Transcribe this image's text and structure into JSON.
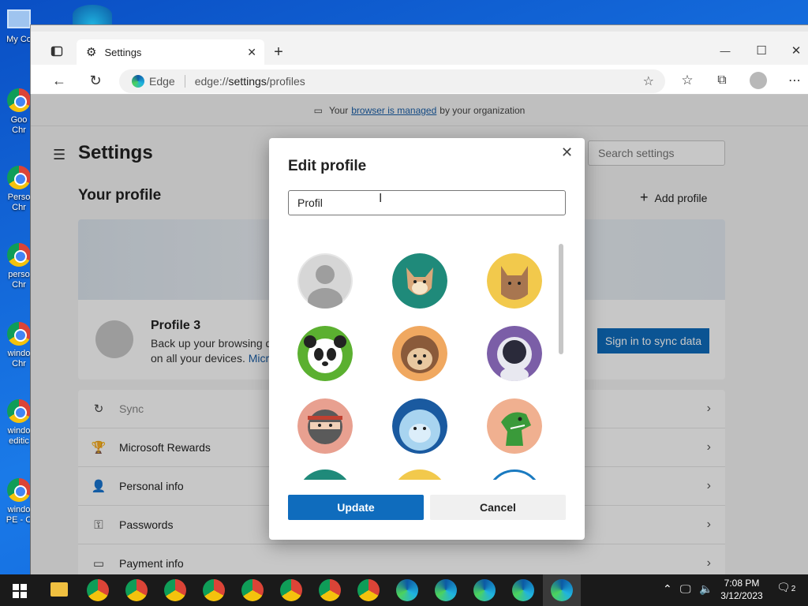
{
  "desktop": {
    "icons": [
      {
        "label": "My Co"
      },
      {
        "label": "Goo Chr"
      },
      {
        "label": "Perso Chr"
      },
      {
        "label": "perso Chr"
      },
      {
        "label": "windo Chr"
      },
      {
        "label": "windo editic"
      },
      {
        "label": "windo PE - C"
      }
    ]
  },
  "browser": {
    "tab_label": "Settings",
    "tab_icon": "gear-icon",
    "new_tab": "+",
    "window_controls": {
      "minimize": "—",
      "maximize": "☐",
      "close": "✕"
    },
    "address": {
      "brand": "Edge",
      "url_scheme": "edge://",
      "url_host": "settings",
      "url_path": "/profiles"
    }
  },
  "settings": {
    "managed_prefix": "Your",
    "managed_link": "browser is managed",
    "managed_suffix": "by your organization",
    "title": "Settings",
    "search_placeholder": "Search settings",
    "your_profile": "Your profile",
    "add_profile": "Add profile",
    "profile_name": "Profile 3",
    "profile_desc": "Back up your browsing d",
    "profile_desc2": "on all your devices.",
    "profile_link": "Micr",
    "sync_button": "Sign in to sync data",
    "list": [
      {
        "label": "Sync",
        "icon": "sync-icon"
      },
      {
        "label": "Microsoft Rewards",
        "icon": "rewards-icon"
      },
      {
        "label": "Personal info",
        "icon": "person-icon"
      },
      {
        "label": "Passwords",
        "icon": "key-icon"
      },
      {
        "label": "Payment info",
        "icon": "card-icon"
      }
    ]
  },
  "dialog": {
    "title": "Edit profile",
    "name_value": "Profil",
    "update": "Update",
    "cancel": "Cancel",
    "avatars": [
      "default-avatar",
      "fox-avatar",
      "cat-avatar",
      "panda-avatar",
      "hedgehog-avatar",
      "astronaut-avatar",
      "ninja-avatar",
      "yeti-avatar",
      "dinosaur-avatar"
    ]
  },
  "taskbar": {
    "time": "7:08 PM",
    "date": "3/12/2023",
    "notifications": "2"
  },
  "colors": {
    "accent": "#0f6cbd",
    "taskbar": "#1a1a1a",
    "desktop": "#1767d6"
  }
}
